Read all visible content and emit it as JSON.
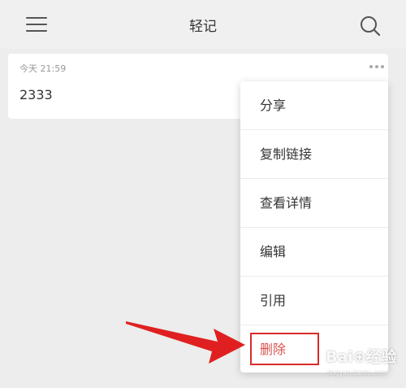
{
  "header": {
    "title": "轻记",
    "menu_icon": "hamburger-menu-icon",
    "search_icon": "search-icon"
  },
  "note": {
    "timestamp": "今天 21:59",
    "content": "2333",
    "more_icon": "more-horizontal-icon"
  },
  "context_menu": {
    "items": [
      {
        "label": "分享"
      },
      {
        "label": "复制链接"
      },
      {
        "label": "查看详情"
      },
      {
        "label": "编辑"
      },
      {
        "label": "引用"
      },
      {
        "label": "删除"
      }
    ]
  },
  "annotation": {
    "arrow_color": "#e02020",
    "highlight_color": "#d92b2b"
  },
  "watermark": {
    "main": "Bai⊕经验",
    "sub": "jingyan.baidu.com"
  },
  "colors": {
    "danger": "#d9534f",
    "background": "#ededed"
  }
}
